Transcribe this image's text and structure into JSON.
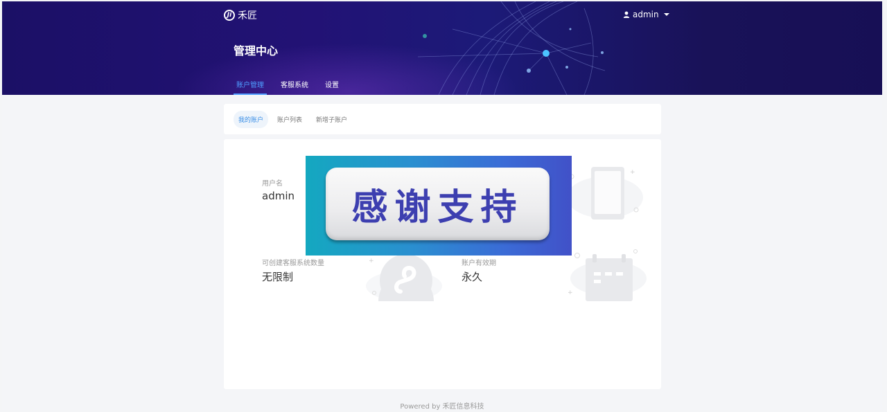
{
  "header": {
    "logo_text": "禾匠",
    "logo_mark": "Ji",
    "user_name": "admin",
    "page_title": "管理中心"
  },
  "nav": {
    "items": [
      {
        "label": "账户管理",
        "active": true
      },
      {
        "label": "客服系统",
        "active": false
      },
      {
        "label": "设置",
        "active": false
      }
    ]
  },
  "subtabs": {
    "items": [
      {
        "label": "我的账户",
        "active": true
      },
      {
        "label": "账户列表",
        "active": false
      },
      {
        "label": "新增子账户",
        "active": false
      }
    ]
  },
  "account": {
    "username_label": "用户名",
    "username_value": "admin",
    "quota_label": "可创建客服系统数量",
    "quota_value": "无限制",
    "expiry_label": "账户有效期",
    "expiry_value": "永久"
  },
  "overlay": {
    "text": "感谢支持"
  },
  "footer": {
    "text": "Powered by 禾匠信息科技"
  },
  "colors": {
    "accent": "#4f9dff",
    "banner": "#1b1066",
    "overlay_text": "#3d3fb0"
  },
  "icons": [
    "user-icon",
    "caret-down-icon",
    "tablet-icon",
    "mini-program-icon",
    "calendar-icon"
  ]
}
